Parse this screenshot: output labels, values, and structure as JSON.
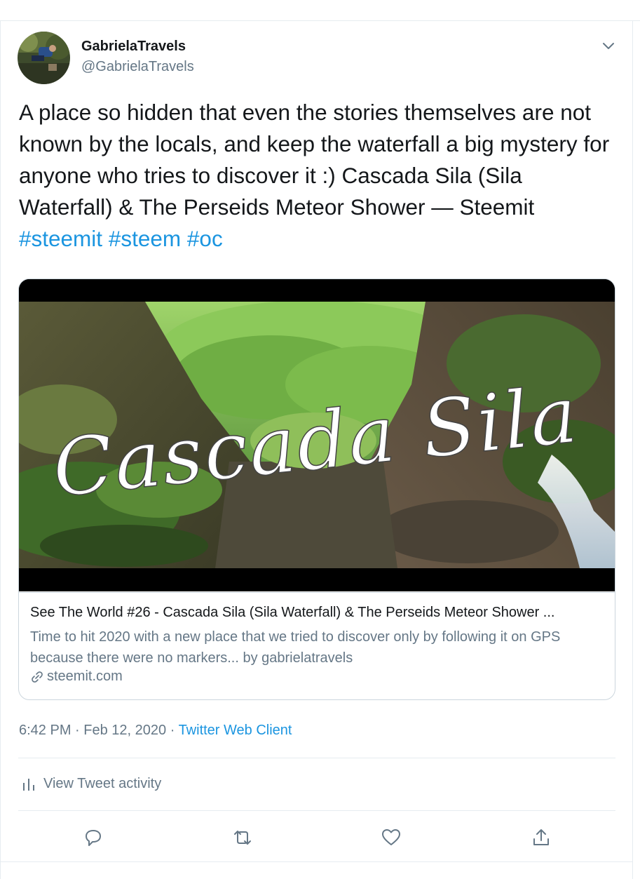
{
  "user": {
    "display_name": "GabrielaTravels",
    "handle": "@GabrielaTravels"
  },
  "tweet": {
    "text": "A place so hidden that even the stories themselves are not known by the locals, and keep the waterfall a big mystery for anyone who tries to discover it :) Cascada Sila (Sila Waterfall) & The Perseids Meteor Shower — Steemit",
    "hashtags": [
      "#steemit",
      "#steem",
      "#oc"
    ]
  },
  "card": {
    "image_text": "Cascada Sila",
    "title": "See The World #26 - Cascada Sila (Sila Waterfall) & The Perseids Meteor Shower ...",
    "description": "Time to hit 2020 with a new place that we tried to discover only by following it on GPS because there were no markers... by gabrielatravels",
    "domain": "steemit.com"
  },
  "meta": {
    "time": "6:42 PM",
    "separator": " · ",
    "date": "Feb 12, 2020",
    "source": "Twitter Web Client"
  },
  "activity": {
    "label": "View Tweet activity"
  },
  "icons": {
    "caret": "chevron-down-icon",
    "reply": "reply-icon",
    "retweet": "retweet-icon",
    "like": "heart-icon",
    "share": "share-icon",
    "link": "link-icon",
    "activity": "bar-chart-icon"
  },
  "colors": {
    "link_blue": "#1b95e0",
    "secondary_gray": "#657786",
    "border": "#ccd6dd",
    "divider": "#e6ecf0"
  }
}
